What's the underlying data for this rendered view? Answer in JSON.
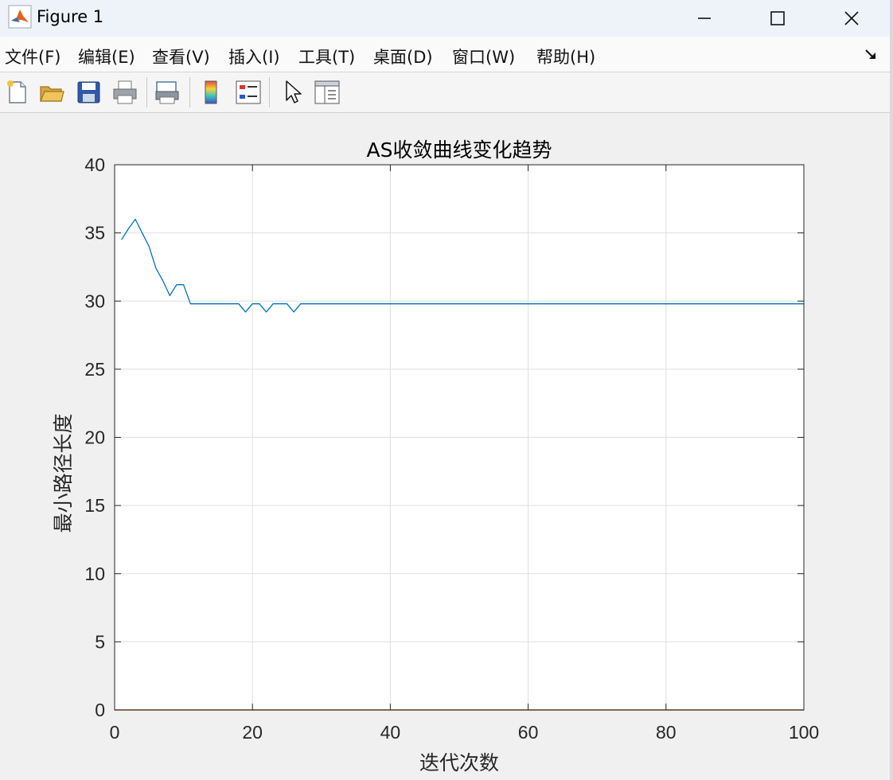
{
  "window": {
    "title": "Figure 1"
  },
  "menu": [
    "文件(F)",
    "编辑(E)",
    "查看(V)",
    "插入(I)",
    "工具(T)",
    "桌面(D)",
    "窗口(W)",
    "帮助(H)"
  ],
  "toolbar": {
    "icons": [
      "new-figure-icon",
      "open-file-icon",
      "save-icon",
      "print-icon",
      "print-preview-icon",
      "colorbar-icon",
      "legend-icon",
      "pointer-icon",
      "property-inspector-icon"
    ]
  },
  "colors": {
    "series": "#0072bd",
    "zero_line": "#d95319",
    "background": "#f0f0f0"
  },
  "chart_data": {
    "type": "line",
    "title": "AS收敛曲线变化趋势",
    "xlabel": "迭代次数",
    "ylabel": "最小路径长度",
    "xlim": [
      0,
      100
    ],
    "ylim": [
      0,
      40
    ],
    "xticks": [
      "0",
      "20",
      "40",
      "60",
      "80",
      "100"
    ],
    "yticks": [
      "0",
      "5",
      "10",
      "15",
      "20",
      "25",
      "30",
      "35",
      "40"
    ],
    "grid": true,
    "series": [
      {
        "x": [
          1,
          2,
          3,
          4,
          5,
          6,
          7,
          8,
          9,
          10,
          11,
          12,
          13,
          14,
          15,
          16,
          17,
          18,
          19,
          20,
          21,
          22,
          23,
          24,
          25,
          26,
          27,
          28,
          29,
          30,
          40,
          50,
          60,
          70,
          80,
          90,
          100
        ],
        "values": [
          34.5,
          35.3,
          36.0,
          35.0,
          34.0,
          32.4,
          31.5,
          30.4,
          31.2,
          31.2,
          29.8,
          29.8,
          29.8,
          29.8,
          29.8,
          29.8,
          29.8,
          29.8,
          29.2,
          29.8,
          29.8,
          29.2,
          29.8,
          29.8,
          29.8,
          29.2,
          29.8,
          29.8,
          29.8,
          29.8,
          29.8,
          29.8,
          29.8,
          29.8,
          29.8,
          29.8,
          29.8
        ]
      },
      {
        "x": [
          0,
          100
        ],
        "values": [
          0,
          0
        ]
      }
    ]
  }
}
